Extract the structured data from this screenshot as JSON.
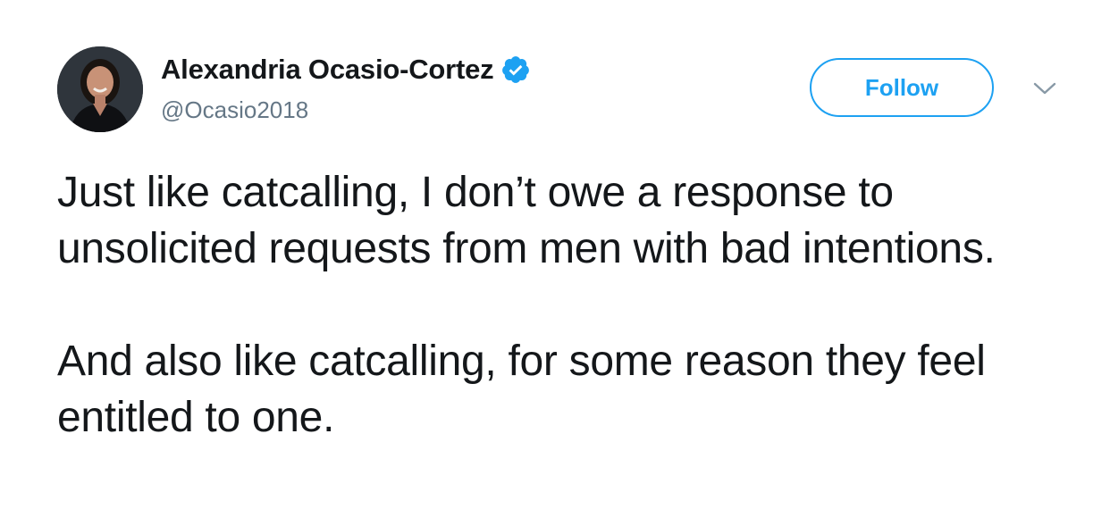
{
  "author": {
    "display_name": "Alexandria Ocasio-Cortez",
    "handle": "@Ocasio2018",
    "verified": true,
    "avatar_icon": "profile-photo"
  },
  "actions": {
    "follow_label": "Follow",
    "menu_icon": "chevron-down-icon"
  },
  "tweet": {
    "paragraphs": [
      "Just like catcalling, I don’t owe a response to unsolicited requests from men with bad intentions.",
      "And also like catcalling, for some reason they feel entitled to one."
    ]
  },
  "colors": {
    "accent": "#1da1f2",
    "text": "#14171a",
    "secondary_text": "#657786"
  }
}
